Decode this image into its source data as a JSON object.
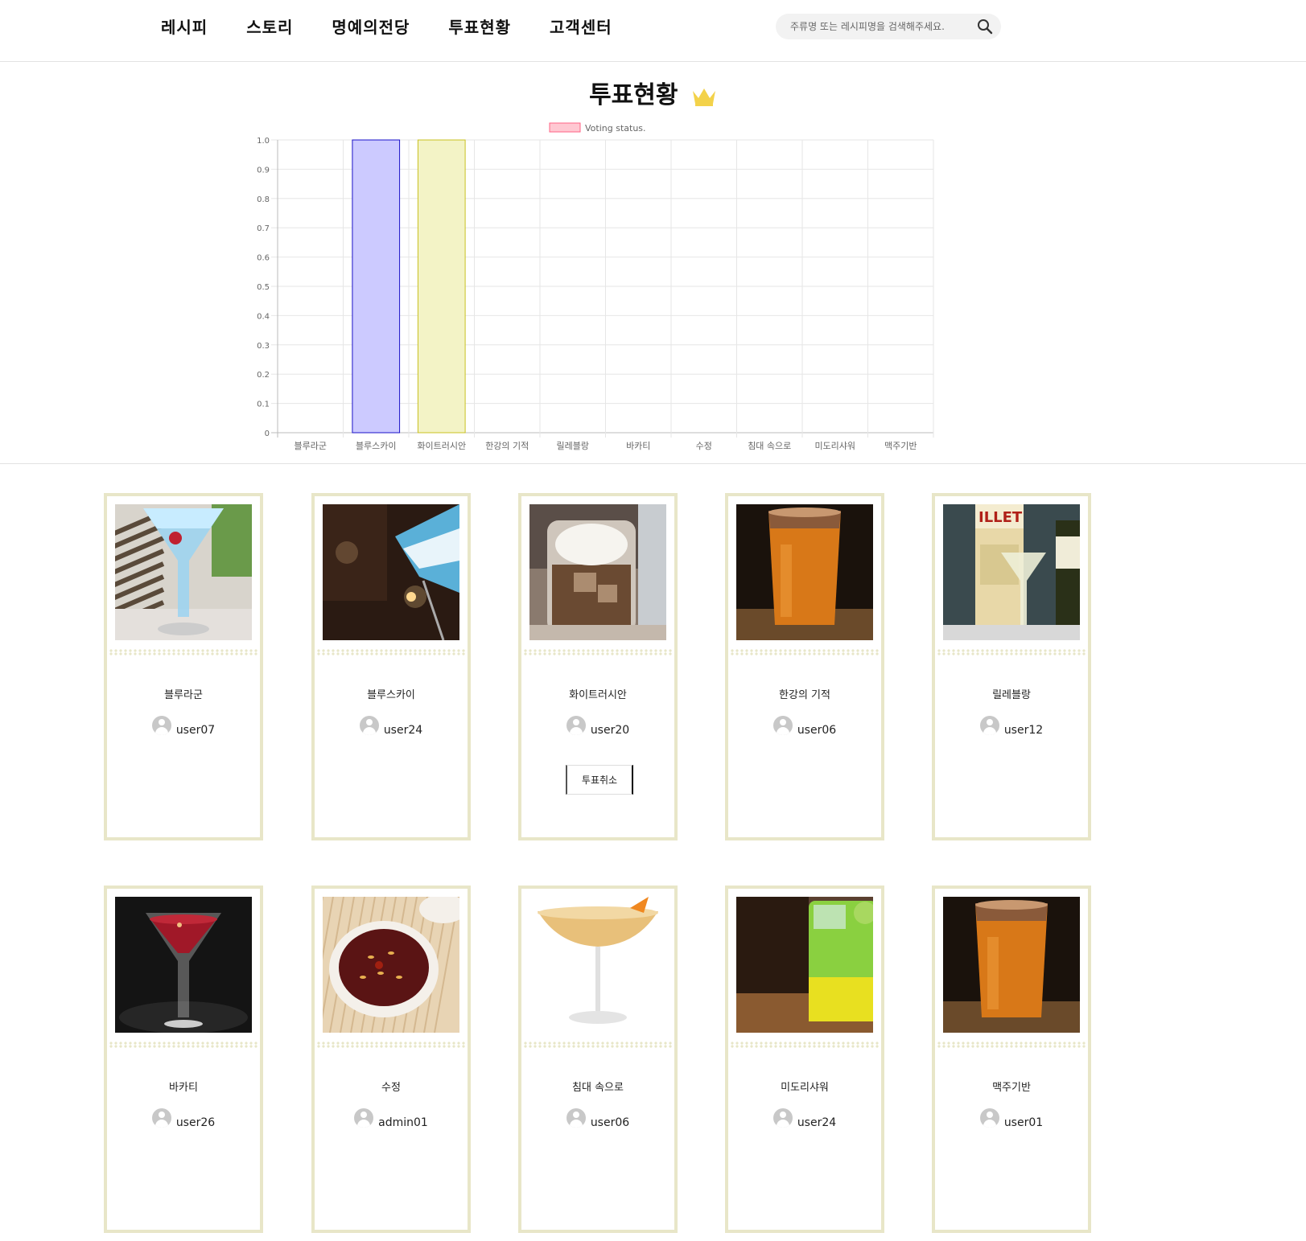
{
  "nav": {
    "items": [
      "레시피",
      "스토리",
      "명예의전당",
      "투표현황",
      "고객센터"
    ]
  },
  "search": {
    "placeholder": "주류명 또는 레시피명을 검색해주세요."
  },
  "page": {
    "title": "투표현황"
  },
  "chart_data": {
    "type": "bar",
    "legend": "Voting status.",
    "legend_color": "#ffc8d2",
    "categories": [
      "블루라군",
      "블루스카이",
      "화이트러시안",
      "한강의 기적",
      "릴레블랑",
      "바카티",
      "수정",
      "침대 속으로",
      "미도리샤워",
      "맥주기반"
    ],
    "values": [
      0,
      1,
      1,
      0,
      0,
      0,
      0,
      0,
      0,
      0
    ],
    "bar_colors": [
      "#ffc8d2",
      "#cccaff",
      "#f3f3c6",
      "#d8f0d8",
      "#f0d8f0",
      "#d8e8f8",
      "#f8e0c8",
      "#e0e0e0",
      "#d0f0f0",
      "#f8d8d8"
    ],
    "bar_borders": [
      "#ff6384",
      "#1a10c8",
      "#c8c020",
      "#40a040",
      "#a040a0",
      "#4080c0",
      "#c08040",
      "#808080",
      "#40a0a0",
      "#c04040"
    ],
    "yticks": [
      "0",
      "0.1",
      "0.2",
      "0.3",
      "0.4",
      "0.5",
      "0.6",
      "0.7",
      "0.8",
      "0.9",
      "1.0"
    ],
    "ylim": [
      0,
      1.0
    ],
    "grid": true,
    "legend_position": "top"
  },
  "cards": [
    {
      "name": "블루라군",
      "user": "user07"
    },
    {
      "name": "블루스카이",
      "user": "user24"
    },
    {
      "name": "화이트러시안",
      "user": "user20",
      "action": "투표취소"
    },
    {
      "name": "한강의 기적",
      "user": "user06"
    },
    {
      "name": "릴레블랑",
      "user": "user12"
    },
    {
      "name": "바카티",
      "user": "user26"
    },
    {
      "name": "수정",
      "user": "admin01"
    },
    {
      "name": "침대 속으로",
      "user": "user06"
    },
    {
      "name": "미도리샤워",
      "user": "user24"
    },
    {
      "name": "맥주기반",
      "user": "user01"
    }
  ],
  "colors": {
    "card_border": "#e8e6c8",
    "crown": "#f3d24a"
  }
}
